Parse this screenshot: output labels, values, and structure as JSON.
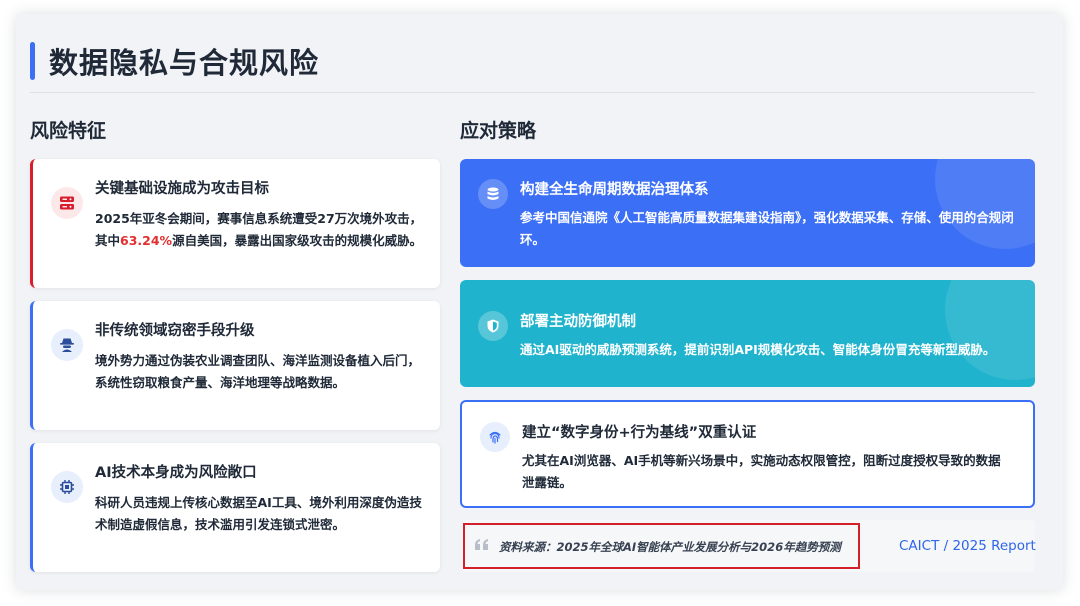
{
  "page": {
    "title": "数据隐私与合规风险"
  },
  "colors": {
    "accent": "#3b6ff5",
    "risk_red": "#d81e2c",
    "risk_blue": "#3b6ff5",
    "strategy_blue": "#3b6ff5",
    "strategy_teal": "#1fb3cd",
    "highlight_red": "#e23030",
    "source_border": "#d4202a"
  },
  "risk_section": {
    "title": "风险特征",
    "cards": [
      {
        "title": "关键基础设施成为攻击目标",
        "body_pre": "2025年亚冬会期间，赛事信息系统遭受27万次境外攻击，其中",
        "body_highlight": "63.24%",
        "body_post": "源自美国，暴露出国家级攻击的规模化威胁。",
        "icon": "server-icon"
      },
      {
        "title": "非传统领域窃密手段升级",
        "body": "境外势力通过伪装农业调查团队、海洋监测设备植入后门，系统性窃取粮食产量、海洋地理等战略数据。",
        "icon": "spy-icon"
      },
      {
        "title": "AI技术本身成为风险敞口",
        "body": "科研人员违规上传核心数据至AI工具、境外利用深度伪造技术制造虚假信息，技术滥用引发连锁式泄密。",
        "icon": "chip-icon"
      }
    ]
  },
  "strategy_section": {
    "title": "应对策略",
    "cards": [
      {
        "title": "构建全生命周期数据治理体系",
        "body": "参考中国信通院《人工智能高质量数据集建设指南》，强化数据采集、存储、使用的合规闭环。",
        "icon": "database-icon"
      },
      {
        "title": "部署主动防御机制",
        "body": "通过AI驱动的威胁预测系统，提前识别API规模化攻击、智能体身份冒充等新型威胁。",
        "icon": "shield-icon"
      },
      {
        "title": "建立“数字身份+行为基线”双重认证",
        "body": "尤其在AI浏览器、AI手机等新兴场景中，实施动态权限管控，阻断过度授权导致的数据泄露链。",
        "icon": "fingerprint-icon"
      }
    ]
  },
  "source": {
    "text": "资料来源：2025年全球AI智能体产业发展分析与2026年趋势预测",
    "link": "CAICT / 2025 Report",
    "icon": "quote-icon"
  }
}
